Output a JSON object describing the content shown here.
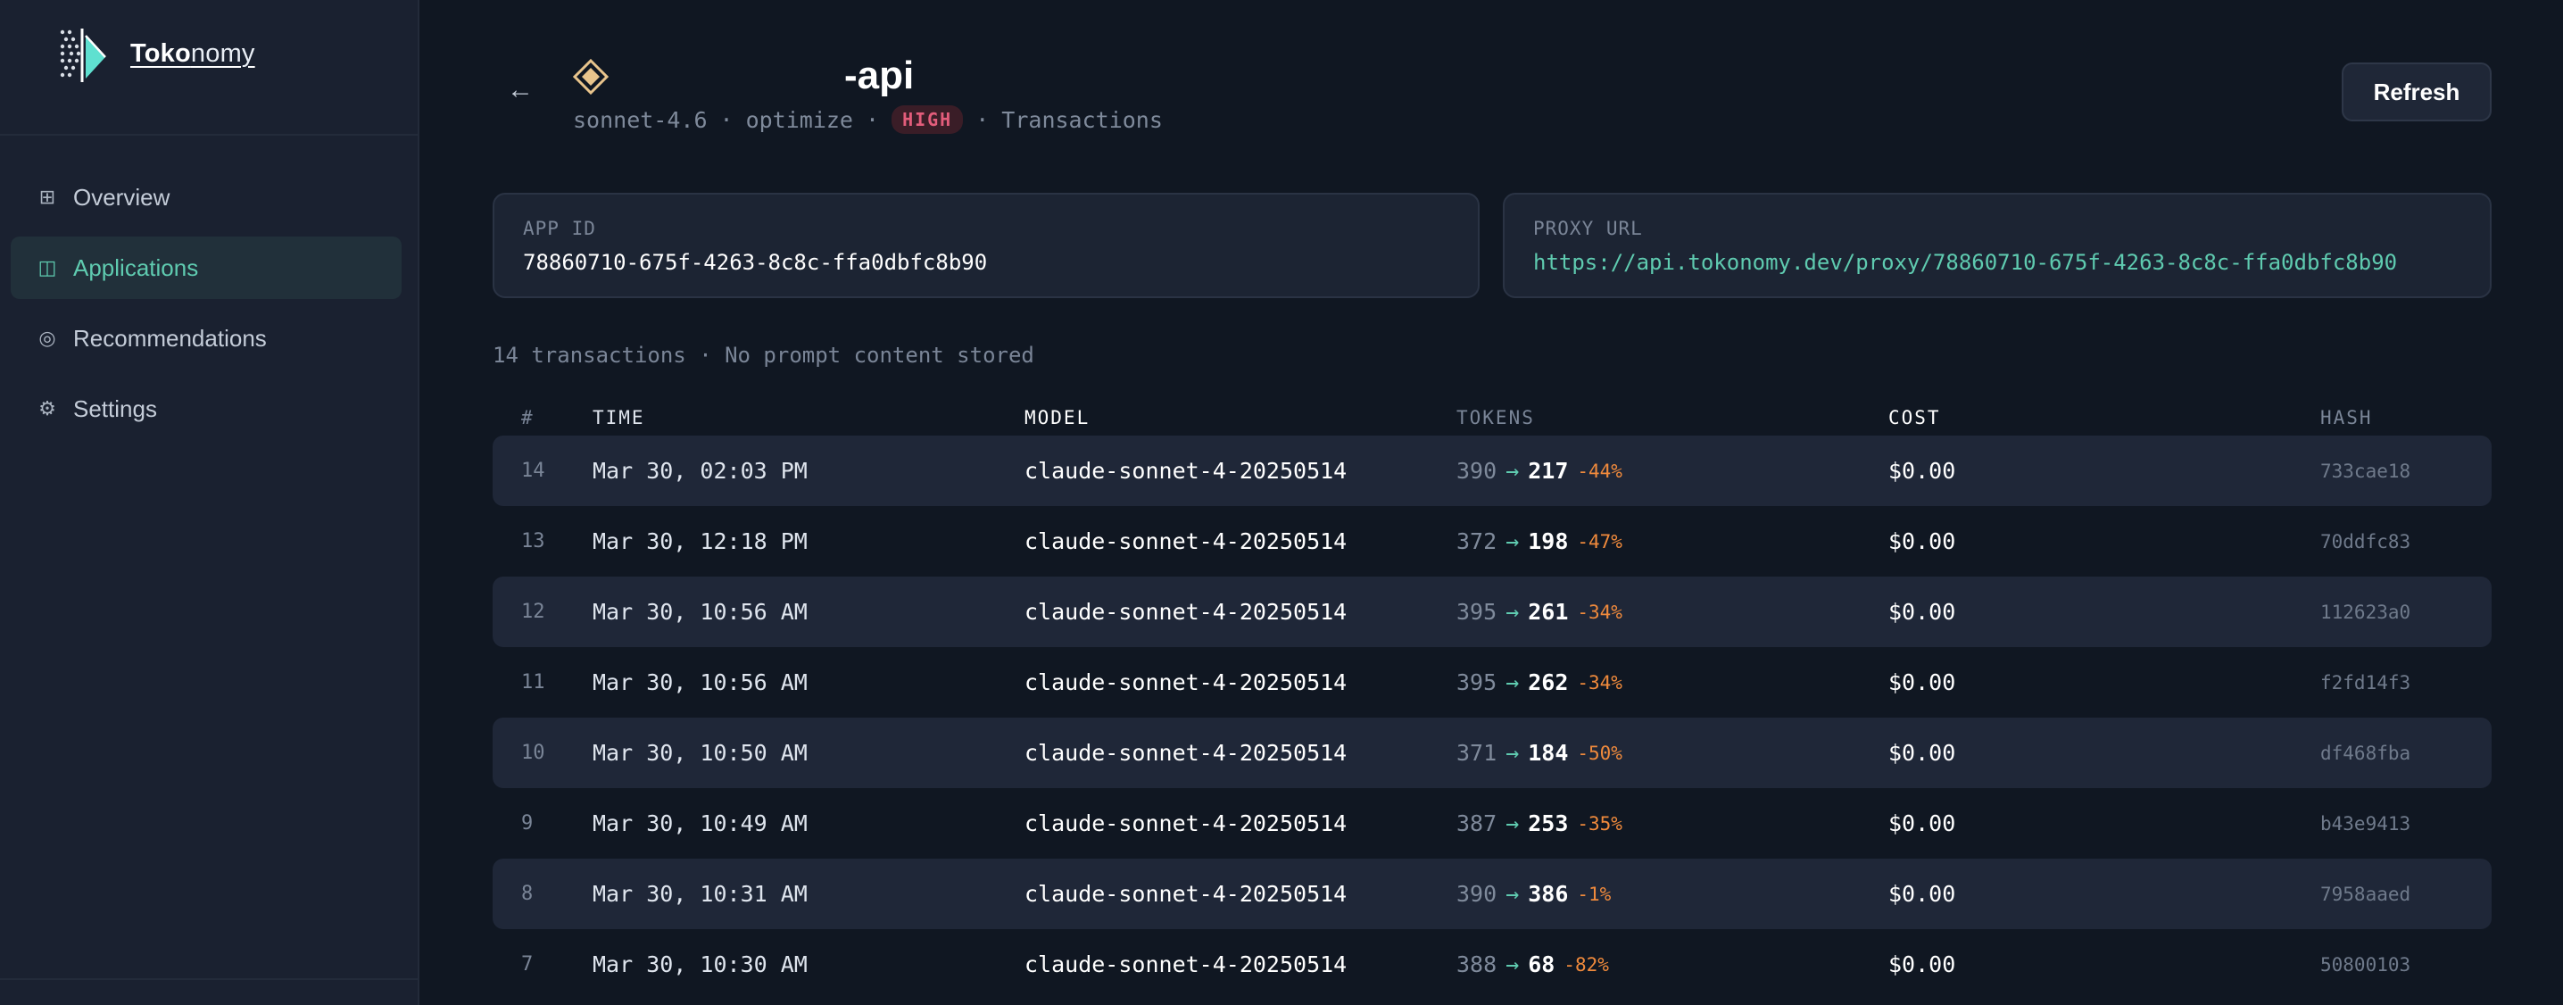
{
  "sidebar": {
    "logo": {
      "bold": "Toko",
      "light": "nomy"
    },
    "items": [
      {
        "label": "Overview",
        "icon": "grid-icon",
        "glyph": "⊞",
        "active": false
      },
      {
        "label": "Applications",
        "icon": "applications-icon",
        "glyph": "◫",
        "active": true
      },
      {
        "label": "Recommendations",
        "icon": "target-icon",
        "glyph": "◎",
        "active": false
      },
      {
        "label": "Settings",
        "icon": "gear-icon",
        "glyph": "⚙",
        "active": false
      }
    ]
  },
  "header": {
    "back": "←",
    "title": "-api",
    "model": "sonnet-4.6",
    "sep": "·",
    "mode": "optimize",
    "level": "HIGH",
    "section": "Transactions",
    "refresh_label": "Refresh"
  },
  "cards": {
    "app_id_label": "APP ID",
    "app_id": "78860710-675f-4263-8c8c-ffa0dbfc8b90",
    "proxy_label": "PROXY URL",
    "proxy_url": "https://api.tokonomy.dev/proxy/78860710-675f-4263-8c8c-ffa0dbfc8b90"
  },
  "summary": "14 transactions · No prompt content stored",
  "table": {
    "columns": [
      "#",
      "TIME",
      "MODEL",
      "TOKENS",
      "COST",
      "HASH"
    ],
    "rows": [
      {
        "num": "14",
        "time": "Mar 30, 02:03 PM",
        "model": "claude-sonnet-4-20250514",
        "tok_in": "390",
        "tok_out": "217",
        "pct": "-44%",
        "cost": "$0.00",
        "hash": "733cae18"
      },
      {
        "num": "13",
        "time": "Mar 30, 12:18 PM",
        "model": "claude-sonnet-4-20250514",
        "tok_in": "372",
        "tok_out": "198",
        "pct": "-47%",
        "cost": "$0.00",
        "hash": "70ddfc83"
      },
      {
        "num": "12",
        "time": "Mar 30, 10:56 AM",
        "model": "claude-sonnet-4-20250514",
        "tok_in": "395",
        "tok_out": "261",
        "pct": "-34%",
        "cost": "$0.00",
        "hash": "112623a0"
      },
      {
        "num": "11",
        "time": "Mar 30, 10:56 AM",
        "model": "claude-sonnet-4-20250514",
        "tok_in": "395",
        "tok_out": "262",
        "pct": "-34%",
        "cost": "$0.00",
        "hash": "f2fd14f3"
      },
      {
        "num": "10",
        "time": "Mar 30, 10:50 AM",
        "model": "claude-sonnet-4-20250514",
        "tok_in": "371",
        "tok_out": "184",
        "pct": "-50%",
        "cost": "$0.00",
        "hash": "df468fba"
      },
      {
        "num": "9",
        "time": "Mar 30, 10:49 AM",
        "model": "claude-sonnet-4-20250514",
        "tok_in": "387",
        "tok_out": "253",
        "pct": "-35%",
        "cost": "$0.00",
        "hash": "b43e9413"
      },
      {
        "num": "8",
        "time": "Mar 30, 10:31 AM",
        "model": "claude-sonnet-4-20250514",
        "tok_in": "390",
        "tok_out": "386",
        "pct": "-1%",
        "cost": "$0.00",
        "hash": "7958aaed"
      },
      {
        "num": "7",
        "time": "Mar 30, 10:30 AM",
        "model": "claude-sonnet-4-20250514",
        "tok_in": "388",
        "tok_out": "68",
        "pct": "-82%",
        "cost": "$0.00",
        "hash": "50800103"
      }
    ]
  },
  "colors": {
    "accent": "#5fcbb0",
    "badge_high": "#e35d7b",
    "savings": "#f08a3c",
    "background": "#101722",
    "sidebar": "#1a2130"
  }
}
